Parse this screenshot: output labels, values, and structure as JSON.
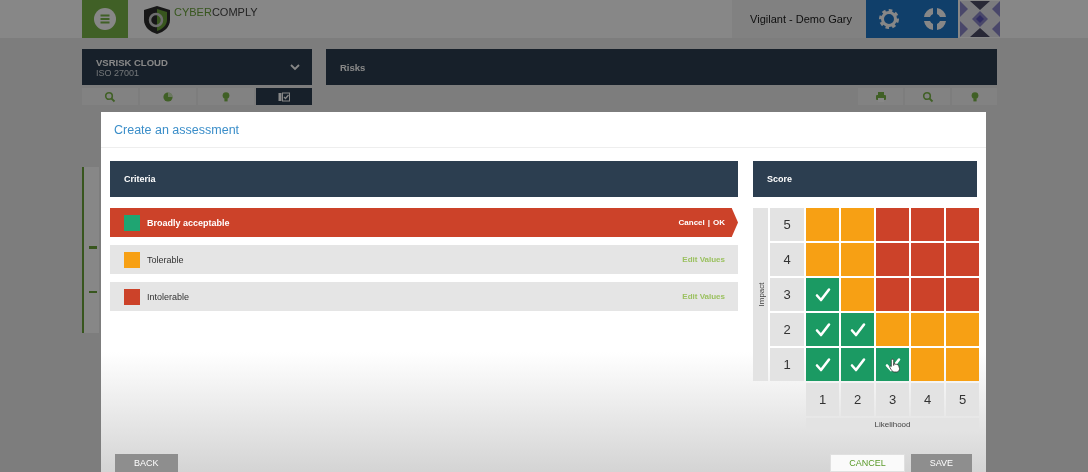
{
  "topbar": {
    "brand": [
      {
        "text": "CYBER",
        "kind": "accent"
      },
      {
        "text": "COMPLY",
        "kind": "plain"
      }
    ],
    "user": "Vigilant - Demo Gary"
  },
  "project": {
    "title": "VSRISK CLOUD",
    "subtitle": "ISO 27001"
  },
  "page_title": "Risks",
  "left_tools": [
    {
      "kind": "search",
      "selected": false
    },
    {
      "kind": "pie",
      "selected": false
    },
    {
      "kind": "bulb",
      "selected": false
    },
    {
      "kind": "checklist",
      "selected": true
    }
  ],
  "right_tools": [
    {
      "kind": "print",
      "selected": false
    },
    {
      "kind": "search",
      "selected": false
    },
    {
      "kind": "bulb",
      "selected": false
    }
  ],
  "modal": {
    "title": "Create an assessment",
    "criteria": {
      "heading": "Criteria",
      "items": [
        {
          "label": "Broadly acceptable",
          "color": "#1fa572",
          "selected": true,
          "actions": [
            "Cancel",
            "OK"
          ],
          "separator": "|"
        },
        {
          "label": "Tolerable",
          "color": "#f7a014",
          "selected": false,
          "actions": [
            "Edit Values"
          ]
        },
        {
          "label": "Intolerable",
          "color": "#cc4229",
          "selected": false,
          "actions": [
            "Edit Values"
          ]
        }
      ]
    },
    "score": {
      "heading": "Score",
      "y_label": "Impact",
      "x_label": "Likelihood",
      "columns": [
        "1",
        "2",
        "3",
        "4",
        "5"
      ],
      "rows": [
        {
          "label": "5",
          "cells": [
            {
              "color": "#f7a014",
              "checked": false,
              "pointer": false
            },
            {
              "color": "#f7a014",
              "checked": false,
              "pointer": false
            },
            {
              "color": "#cc4229",
              "checked": false,
              "pointer": false
            },
            {
              "color": "#cc4229",
              "checked": false,
              "pointer": false
            },
            {
              "color": "#cc4229",
              "checked": false,
              "pointer": false
            }
          ]
        },
        {
          "label": "4",
          "cells": [
            {
              "color": "#f7a014",
              "checked": false,
              "pointer": false
            },
            {
              "color": "#f7a014",
              "checked": false,
              "pointer": false
            },
            {
              "color": "#cc4229",
              "checked": false,
              "pointer": false
            },
            {
              "color": "#cc4229",
              "checked": false,
              "pointer": false
            },
            {
              "color": "#cc4229",
              "checked": false,
              "pointer": false
            }
          ]
        },
        {
          "label": "3",
          "cells": [
            {
              "color": "#1b9a63",
              "checked": true,
              "pointer": false
            },
            {
              "color": "#f7a014",
              "checked": false,
              "pointer": false
            },
            {
              "color": "#cc4229",
              "checked": false,
              "pointer": false
            },
            {
              "color": "#cc4229",
              "checked": false,
              "pointer": false
            },
            {
              "color": "#cc4229",
              "checked": false,
              "pointer": false
            }
          ]
        },
        {
          "label": "2",
          "cells": [
            {
              "color": "#1b9a63",
              "checked": true,
              "pointer": false
            },
            {
              "color": "#1b9a63",
              "checked": true,
              "pointer": false
            },
            {
              "color": "#f7a014",
              "checked": false,
              "pointer": false
            },
            {
              "color": "#f7a014",
              "checked": false,
              "pointer": false
            },
            {
              "color": "#f7a014",
              "checked": false,
              "pointer": false
            }
          ]
        },
        {
          "label": "1",
          "cells": [
            {
              "color": "#1b9a63",
              "checked": true,
              "pointer": false
            },
            {
              "color": "#1b9a63",
              "checked": true,
              "pointer": false
            },
            {
              "color": "#1b9a63",
              "checked": true,
              "pointer": true
            },
            {
              "color": "#f7a014",
              "checked": false,
              "pointer": false
            },
            {
              "color": "#f7a014",
              "checked": false,
              "pointer": false
            }
          ]
        }
      ]
    },
    "buttons": [
      {
        "label": "BACK",
        "disabled": true
      },
      {
        "label": "CANCEL",
        "disabled": false
      },
      {
        "label": "SAVE",
        "disabled": true
      }
    ]
  }
}
